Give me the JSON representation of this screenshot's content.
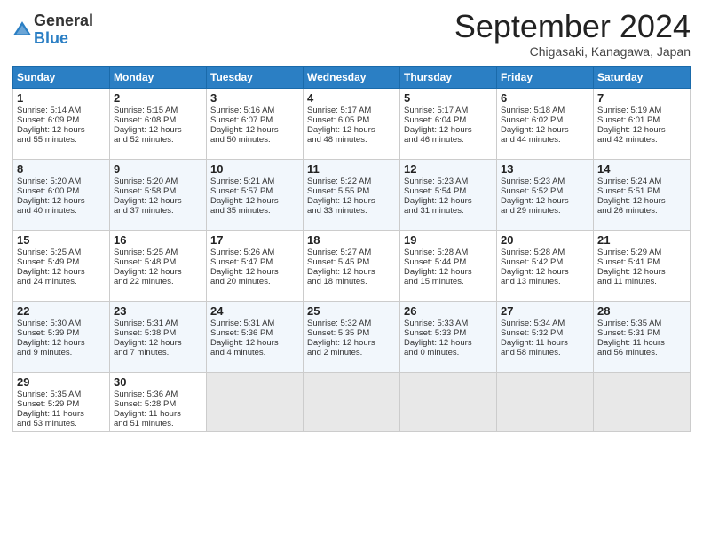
{
  "header": {
    "logo_line1": "General",
    "logo_line2": "Blue",
    "month": "September 2024",
    "location": "Chigasaki, Kanagawa, Japan"
  },
  "weekdays": [
    "Sunday",
    "Monday",
    "Tuesday",
    "Wednesday",
    "Thursday",
    "Friday",
    "Saturday"
  ],
  "weeks": [
    [
      {
        "day": "1",
        "lines": [
          "Sunrise: 5:14 AM",
          "Sunset: 6:09 PM",
          "Daylight: 12 hours",
          "and 55 minutes."
        ]
      },
      {
        "day": "2",
        "lines": [
          "Sunrise: 5:15 AM",
          "Sunset: 6:08 PM",
          "Daylight: 12 hours",
          "and 52 minutes."
        ]
      },
      {
        "day": "3",
        "lines": [
          "Sunrise: 5:16 AM",
          "Sunset: 6:07 PM",
          "Daylight: 12 hours",
          "and 50 minutes."
        ]
      },
      {
        "day": "4",
        "lines": [
          "Sunrise: 5:17 AM",
          "Sunset: 6:05 PM",
          "Daylight: 12 hours",
          "and 48 minutes."
        ]
      },
      {
        "day": "5",
        "lines": [
          "Sunrise: 5:17 AM",
          "Sunset: 6:04 PM",
          "Daylight: 12 hours",
          "and 46 minutes."
        ]
      },
      {
        "day": "6",
        "lines": [
          "Sunrise: 5:18 AM",
          "Sunset: 6:02 PM",
          "Daylight: 12 hours",
          "and 44 minutes."
        ]
      },
      {
        "day": "7",
        "lines": [
          "Sunrise: 5:19 AM",
          "Sunset: 6:01 PM",
          "Daylight: 12 hours",
          "and 42 minutes."
        ]
      }
    ],
    [
      {
        "day": "8",
        "lines": [
          "Sunrise: 5:20 AM",
          "Sunset: 6:00 PM",
          "Daylight: 12 hours",
          "and 40 minutes."
        ]
      },
      {
        "day": "9",
        "lines": [
          "Sunrise: 5:20 AM",
          "Sunset: 5:58 PM",
          "Daylight: 12 hours",
          "and 37 minutes."
        ]
      },
      {
        "day": "10",
        "lines": [
          "Sunrise: 5:21 AM",
          "Sunset: 5:57 PM",
          "Daylight: 12 hours",
          "and 35 minutes."
        ]
      },
      {
        "day": "11",
        "lines": [
          "Sunrise: 5:22 AM",
          "Sunset: 5:55 PM",
          "Daylight: 12 hours",
          "and 33 minutes."
        ]
      },
      {
        "day": "12",
        "lines": [
          "Sunrise: 5:23 AM",
          "Sunset: 5:54 PM",
          "Daylight: 12 hours",
          "and 31 minutes."
        ]
      },
      {
        "day": "13",
        "lines": [
          "Sunrise: 5:23 AM",
          "Sunset: 5:52 PM",
          "Daylight: 12 hours",
          "and 29 minutes."
        ]
      },
      {
        "day": "14",
        "lines": [
          "Sunrise: 5:24 AM",
          "Sunset: 5:51 PM",
          "Daylight: 12 hours",
          "and 26 minutes."
        ]
      }
    ],
    [
      {
        "day": "15",
        "lines": [
          "Sunrise: 5:25 AM",
          "Sunset: 5:49 PM",
          "Daylight: 12 hours",
          "and 24 minutes."
        ]
      },
      {
        "day": "16",
        "lines": [
          "Sunrise: 5:25 AM",
          "Sunset: 5:48 PM",
          "Daylight: 12 hours",
          "and 22 minutes."
        ]
      },
      {
        "day": "17",
        "lines": [
          "Sunrise: 5:26 AM",
          "Sunset: 5:47 PM",
          "Daylight: 12 hours",
          "and 20 minutes."
        ]
      },
      {
        "day": "18",
        "lines": [
          "Sunrise: 5:27 AM",
          "Sunset: 5:45 PM",
          "Daylight: 12 hours",
          "and 18 minutes."
        ]
      },
      {
        "day": "19",
        "lines": [
          "Sunrise: 5:28 AM",
          "Sunset: 5:44 PM",
          "Daylight: 12 hours",
          "and 15 minutes."
        ]
      },
      {
        "day": "20",
        "lines": [
          "Sunrise: 5:28 AM",
          "Sunset: 5:42 PM",
          "Daylight: 12 hours",
          "and 13 minutes."
        ]
      },
      {
        "day": "21",
        "lines": [
          "Sunrise: 5:29 AM",
          "Sunset: 5:41 PM",
          "Daylight: 12 hours",
          "and 11 minutes."
        ]
      }
    ],
    [
      {
        "day": "22",
        "lines": [
          "Sunrise: 5:30 AM",
          "Sunset: 5:39 PM",
          "Daylight: 12 hours",
          "and 9 minutes."
        ]
      },
      {
        "day": "23",
        "lines": [
          "Sunrise: 5:31 AM",
          "Sunset: 5:38 PM",
          "Daylight: 12 hours",
          "and 7 minutes."
        ]
      },
      {
        "day": "24",
        "lines": [
          "Sunrise: 5:31 AM",
          "Sunset: 5:36 PM",
          "Daylight: 12 hours",
          "and 4 minutes."
        ]
      },
      {
        "day": "25",
        "lines": [
          "Sunrise: 5:32 AM",
          "Sunset: 5:35 PM",
          "Daylight: 12 hours",
          "and 2 minutes."
        ]
      },
      {
        "day": "26",
        "lines": [
          "Sunrise: 5:33 AM",
          "Sunset: 5:33 PM",
          "Daylight: 12 hours",
          "and 0 minutes."
        ]
      },
      {
        "day": "27",
        "lines": [
          "Sunrise: 5:34 AM",
          "Sunset: 5:32 PM",
          "Daylight: 11 hours",
          "and 58 minutes."
        ]
      },
      {
        "day": "28",
        "lines": [
          "Sunrise: 5:35 AM",
          "Sunset: 5:31 PM",
          "Daylight: 11 hours",
          "and 56 minutes."
        ]
      }
    ],
    [
      {
        "day": "29",
        "lines": [
          "Sunrise: 5:35 AM",
          "Sunset: 5:29 PM",
          "Daylight: 11 hours",
          "and 53 minutes."
        ]
      },
      {
        "day": "30",
        "lines": [
          "Sunrise: 5:36 AM",
          "Sunset: 5:28 PM",
          "Daylight: 11 hours",
          "and 51 minutes."
        ]
      },
      {
        "day": "",
        "lines": []
      },
      {
        "day": "",
        "lines": []
      },
      {
        "day": "",
        "lines": []
      },
      {
        "day": "",
        "lines": []
      },
      {
        "day": "",
        "lines": []
      }
    ]
  ]
}
